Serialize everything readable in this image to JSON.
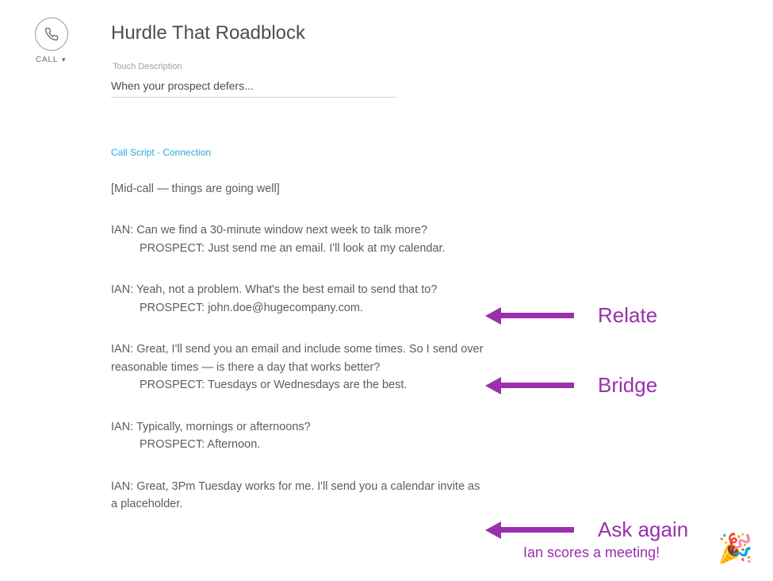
{
  "left": {
    "call_label": "CALL"
  },
  "header": {
    "title": "Hurdle That Roadblock",
    "touch_label": "Touch Description",
    "touch_value": "When your prospect defers..."
  },
  "script_link": "Call Script - Connection",
  "script": {
    "intro": "[Mid-call — things are going well]",
    "l1_ian": "IAN: Can we find a 30-minute window next week to talk more?",
    "l1_prospect": "PROSPECT: Just send me an email. I'll look at my calendar.",
    "l2_ian": "IAN: Yeah, not a problem. What's the best email to send that to?",
    "l2_prospect": "PROSPECT: john.doe@hugecompany.com.",
    "l3_ian": "IAN: Great, I'll send you an email and include some times. So I send over reasonable times — is there a day that works better?",
    "l3_prospect": "PROSPECT: Tuesdays or Wednesdays are the best.",
    "l4_ian": "IAN: Typically, mornings or afternoons?",
    "l4_prospect": "PROSPECT: Afternoon.",
    "l5_ian": "IAN: Great, 3Pm Tuesday works for me. I'll send you a calendar invite as a placeholder."
  },
  "annotations": {
    "relate": "Relate",
    "bridge": "Bridge",
    "ask_again": "Ask again",
    "sub": "Ian scores a meeting!",
    "party": "🎉"
  }
}
